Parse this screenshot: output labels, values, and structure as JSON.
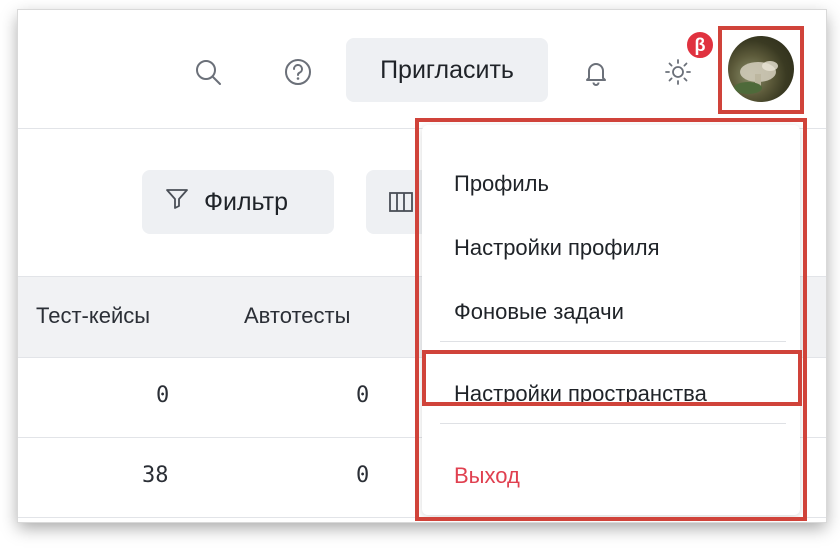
{
  "header": {
    "invite_label": "Пригласить",
    "beta_badge": "β",
    "icons": {
      "search": "search-icon",
      "help": "help-icon",
      "notifications": "bell-icon",
      "theme": "sun-icon"
    }
  },
  "toolbar": {
    "filter_label": "Фильтр",
    "columns_icon": "columns-icon"
  },
  "table": {
    "columns": [
      "Тест-кейсы",
      "Автотесты"
    ],
    "rows": [
      [
        "0",
        "0"
      ],
      [
        "38",
        "0"
      ]
    ]
  },
  "profile_menu": {
    "items": [
      {
        "label": "Профиль"
      },
      {
        "label": "Настройки профиля"
      },
      {
        "label": "Фоновые задачи"
      },
      {
        "label": "Настройки пространства"
      },
      {
        "label": "Выход"
      }
    ],
    "highlight_color": "#d0433a",
    "logout_color": "#e04050"
  }
}
